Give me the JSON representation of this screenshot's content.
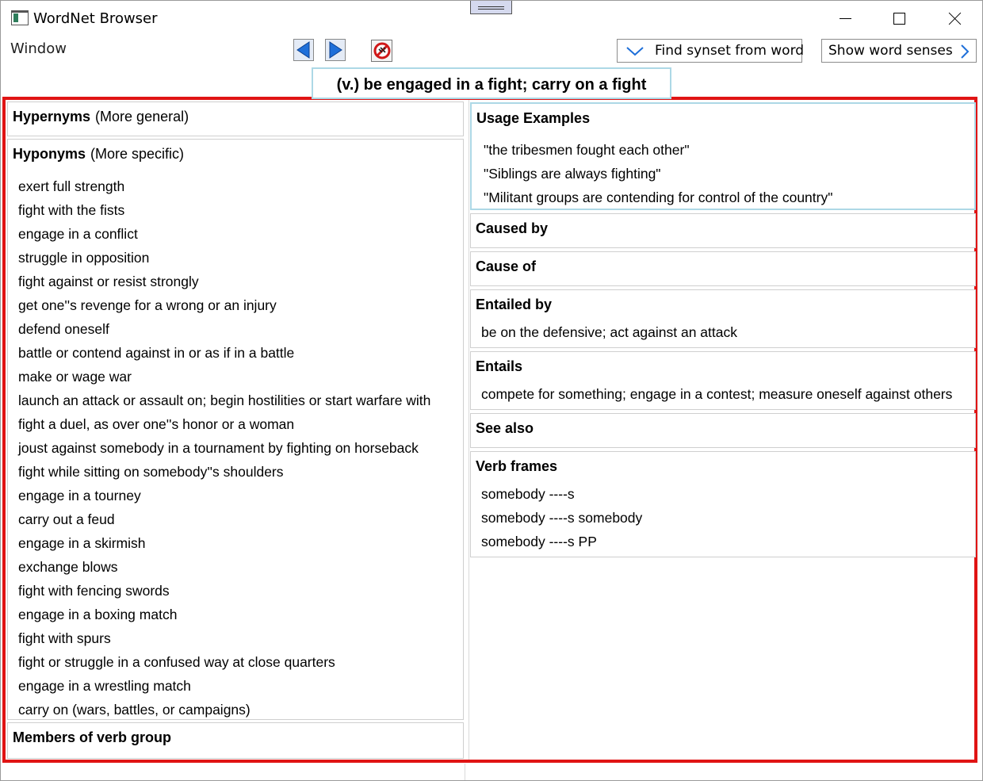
{
  "window": {
    "title": "WordNet Browser",
    "menu_window": "Window"
  },
  "toolbar": {
    "back_icon": "left-arrow",
    "forward_icon": "right-arrow",
    "stop_icon": "no-entry",
    "find_synset_label": "Find synset from word",
    "show_senses_label": "Show word senses"
  },
  "gloss": "(v.) be engaged in a fight; carry on a fight",
  "left": {
    "hypernyms": {
      "title": "Hypernyms",
      "subtitle": "(More general)"
    },
    "hyponyms": {
      "title": "Hyponyms",
      "subtitle": "(More specific)",
      "items": [
        "exert full strength",
        "fight with the fists",
        "engage in a conflict",
        "struggle in opposition",
        "fight against or resist strongly",
        "get one''s revenge for a wrong or an injury",
        "defend oneself",
        "battle or contend against in or as if in a battle",
        "make or wage war",
        "launch an attack or assault on; begin hostilities or start warfare with",
        "fight a duel, as over one''s honor or a woman",
        "joust against somebody in a tournament by fighting on horseback",
        "fight while sitting on somebody''s shoulders",
        "engage in a tourney",
        "carry out a feud",
        "engage in a skirmish",
        "exchange blows",
        "fight with fencing swords",
        "engage in a boxing match",
        "fight with spurs",
        "fight or struggle in a confused way at close quarters",
        "engage in a wrestling match",
        "carry on (wars, battles, or campaigns)"
      ]
    },
    "members": {
      "title": "Members of verb group"
    }
  },
  "right": {
    "usage": {
      "title": "Usage Examples",
      "items": [
        "\"the tribesmen fought each other\"",
        "\"Siblings are always fighting\"",
        "\"Militant groups are contending for control of the country\""
      ]
    },
    "caused_by": {
      "title": "Caused by"
    },
    "cause_of": {
      "title": "Cause of"
    },
    "entailed_by": {
      "title": "Entailed by",
      "items": [
        "be on the defensive; act against an attack"
      ]
    },
    "entails": {
      "title": "Entails",
      "items": [
        "compete for something; engage in a contest; measure oneself against others"
      ]
    },
    "see_also": {
      "title": "See also"
    },
    "verb_frames": {
      "title": "Verb frames",
      "items": [
        "somebody ----s",
        "somebody ----s somebody",
        "somebody ----s PP"
      ]
    }
  },
  "colors": {
    "highlight_border": "#e01414",
    "accent_border": "#add8e6",
    "arrow_blue": "#1e6fd9"
  }
}
